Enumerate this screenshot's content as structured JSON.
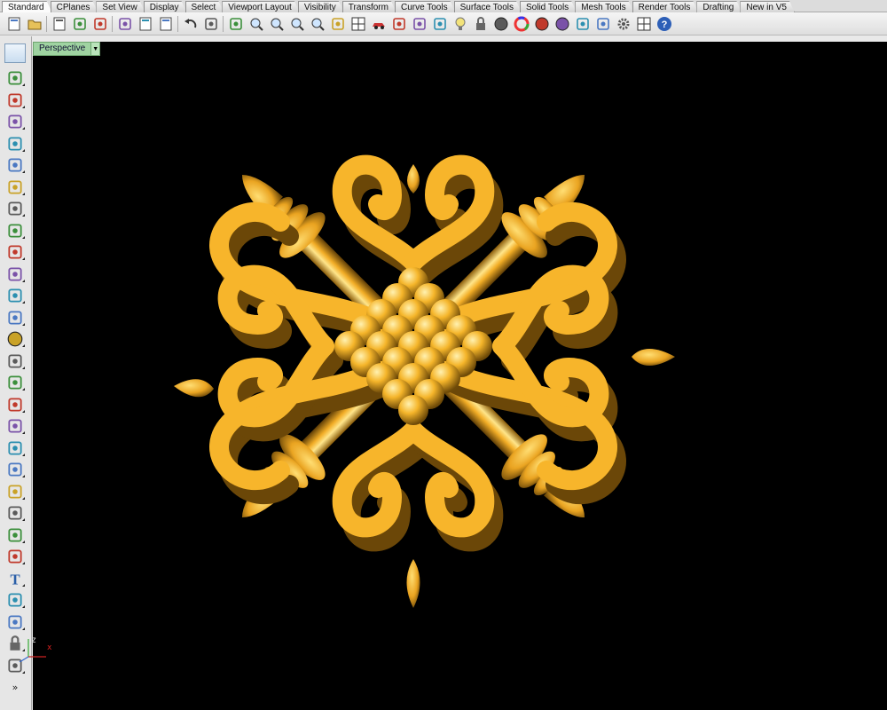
{
  "toolbar_tabs": [
    "Standard",
    "CPlanes",
    "Set View",
    "Display",
    "Select",
    "Viewport Layout",
    "Visibility",
    "Transform",
    "Curve Tools",
    "Surface Tools",
    "Solid Tools",
    "Mesh Tools",
    "Render Tools",
    "Drafting",
    "New in V5"
  ],
  "active_tab": "Standard",
  "toolbar_icons": [
    "new-icon",
    "open-icon",
    "save-icon",
    "print-icon",
    "import-icon",
    "cut-icon",
    "copy-icon",
    "paste-icon",
    "undo-icon",
    "pan-hand-icon",
    "move-view-icon",
    "zoom-icon",
    "zoom-window-icon",
    "zoom-extents-icon",
    "zoom-selected-icon",
    "rotate-view-icon",
    "four-viewports-icon",
    "car-icon",
    "named-view-icon",
    "snapshot-icon",
    "cplane-icon",
    "light-icon",
    "lock-icon",
    "shaded-icon",
    "color-wheel-icon",
    "rendered-icon",
    "ghosted-icon",
    "render-icon",
    "material-icon",
    "options-gear-icon",
    "grid-snap-icon",
    "help-icon"
  ],
  "left_toolbar_icons": [
    "select-icon",
    "point-icon",
    "polyline-icon",
    "curve-icon",
    "circle-icon",
    "ellipse-icon",
    "arc-icon",
    "rectangle-icon",
    "polygon-icon",
    "fillet-icon",
    "surface-corner-icon",
    "extrude-icon",
    "box-icon",
    "sphere-icon",
    "cylinder-icon",
    "plane-icon",
    "boolean-icon",
    "mesh-icon",
    "transform-icon",
    "trim-icon",
    "split-icon",
    "join-icon",
    "explode-icon",
    "offset-icon",
    "text-icon",
    "dimension-icon",
    "array-icon",
    "block-icon",
    "render-box-icon",
    "more-icon"
  ],
  "viewport": {
    "label": "Perspective",
    "dropdown_glyph": "▼",
    "background": "#000000"
  },
  "axes": {
    "z": "z",
    "x": "x"
  },
  "colors": {
    "model_gold": "#f5b32c",
    "model_shadow": "#7a5210",
    "viewport_tab": "#9fd3a1"
  }
}
